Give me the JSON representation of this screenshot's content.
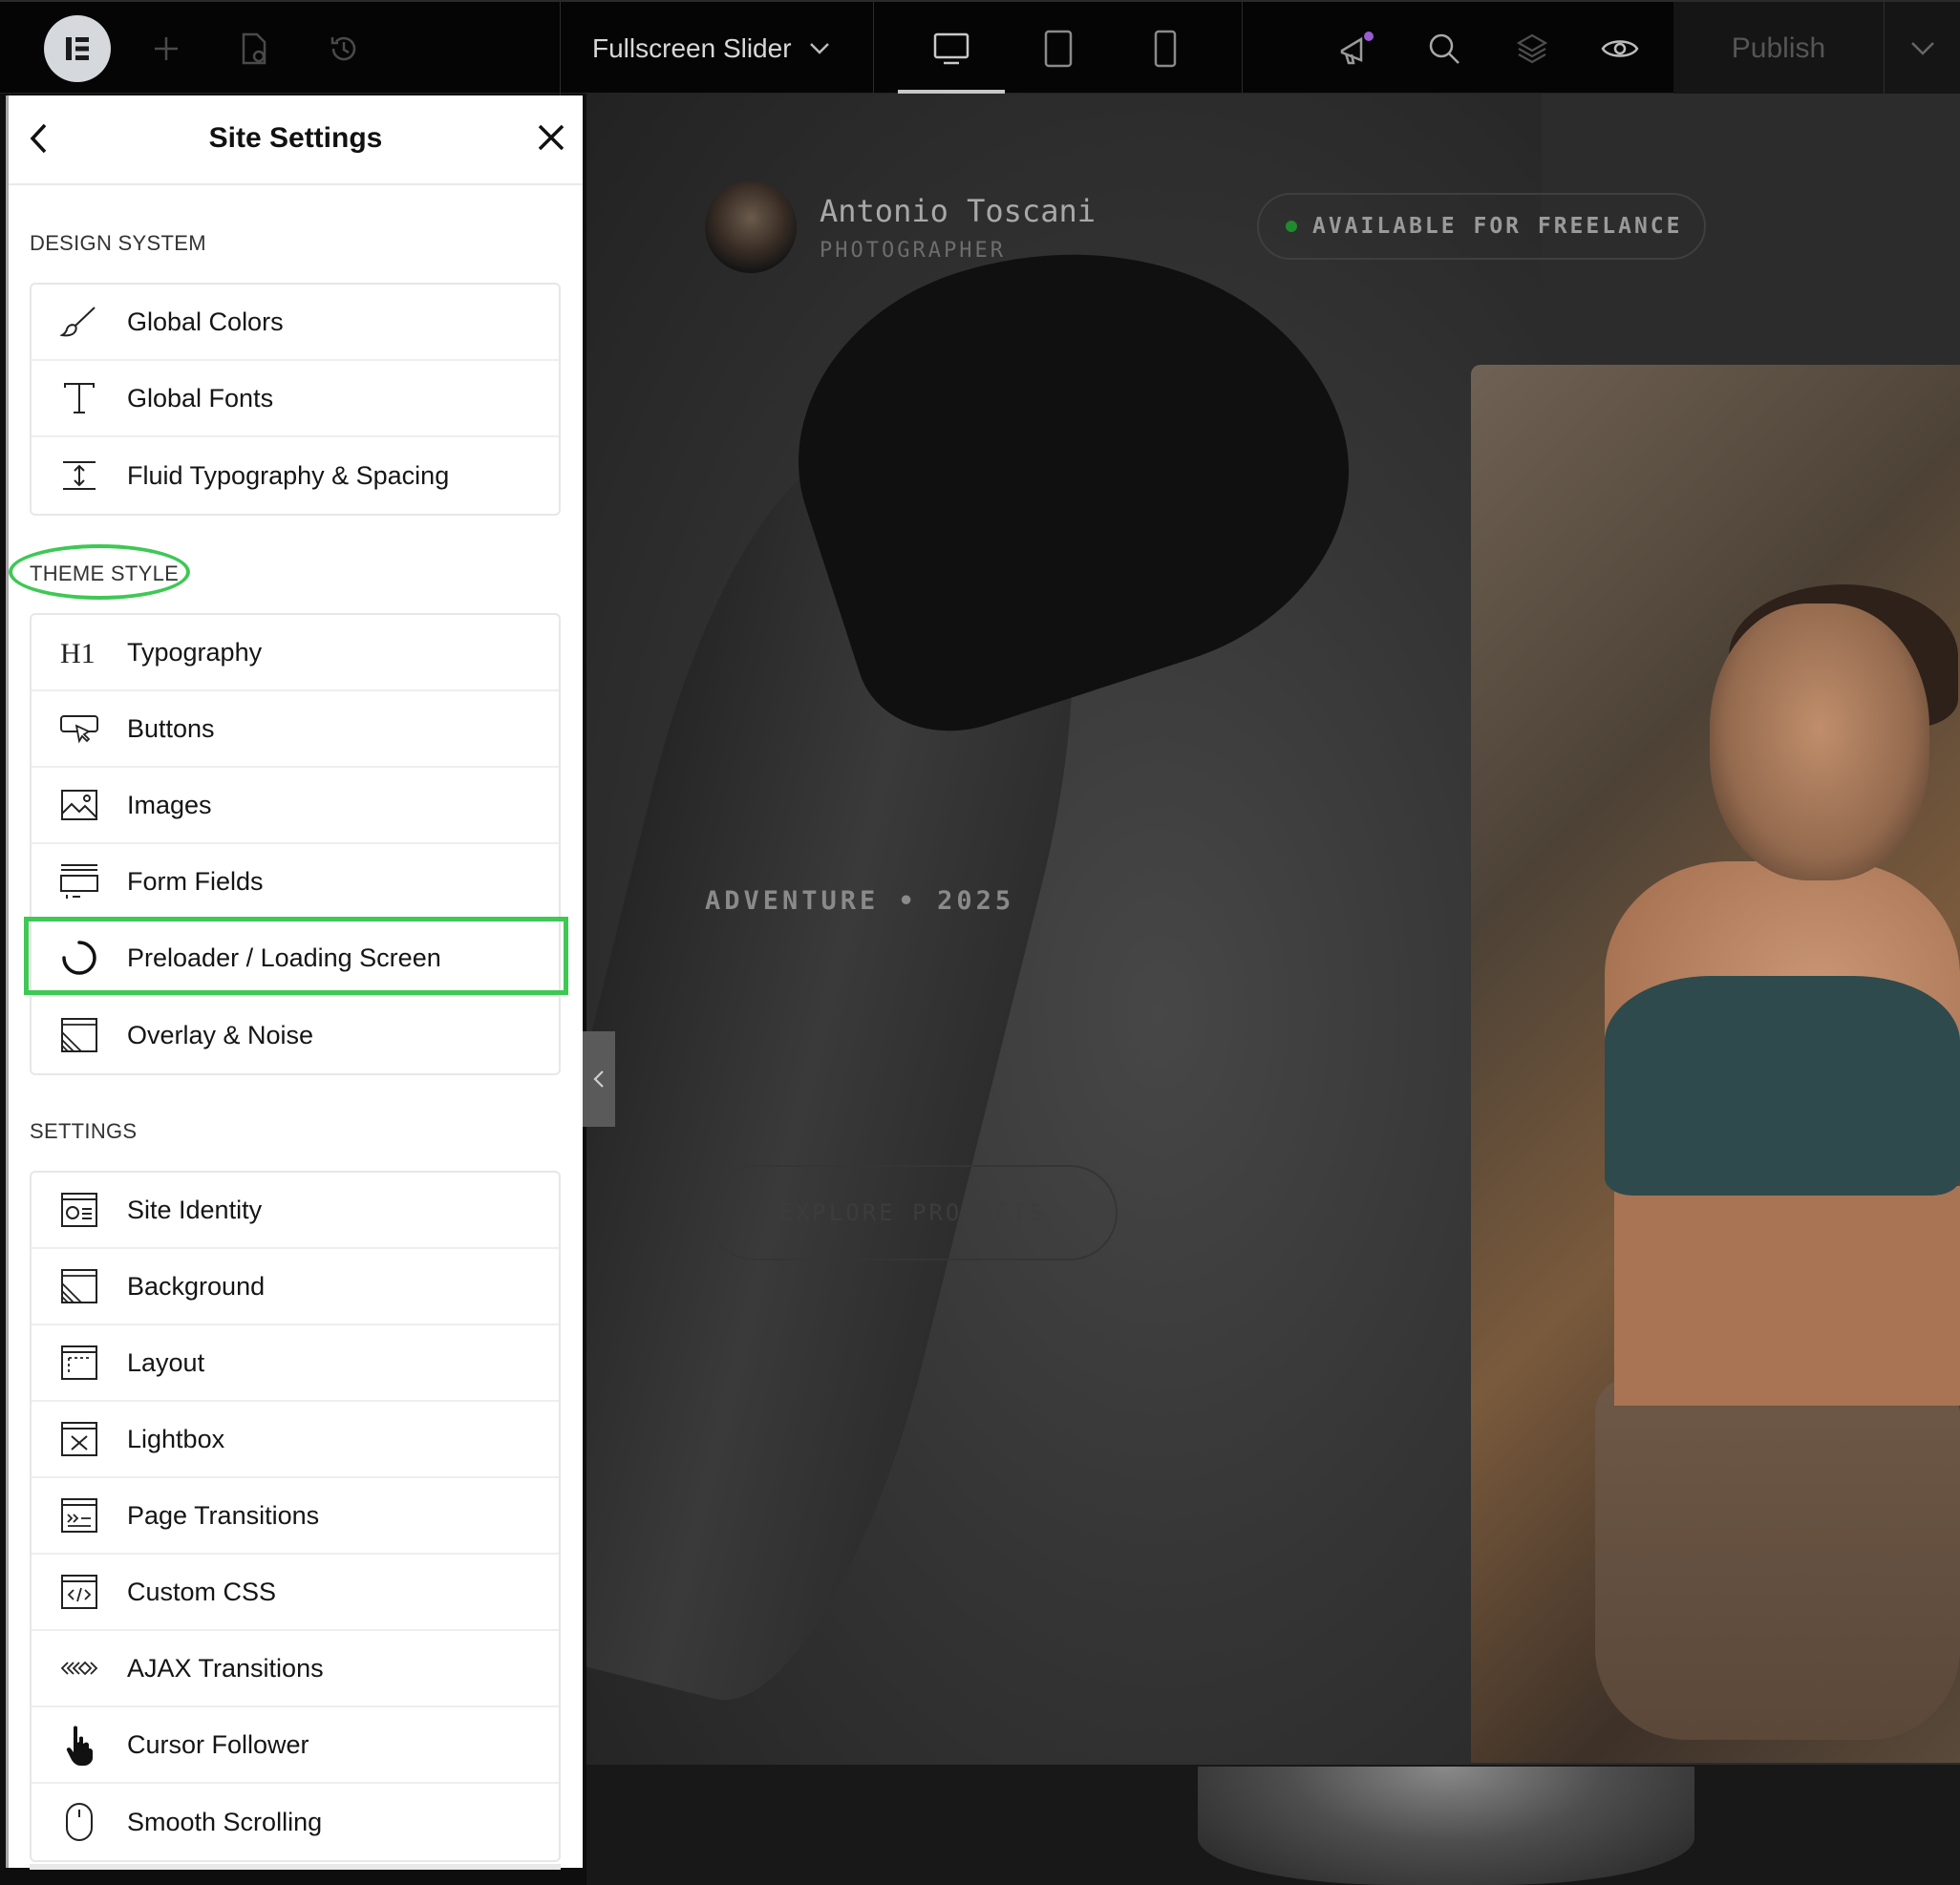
{
  "topbar": {
    "document_title": "Fullscreen Slider",
    "publish_label": "Publish"
  },
  "panel": {
    "title": "Site Settings",
    "sections": [
      {
        "label": "DESIGN SYSTEM",
        "items": [
          {
            "label": "Global Colors",
            "icon": "brush-icon"
          },
          {
            "label": "Global Fonts",
            "icon": "text-t-icon"
          },
          {
            "label": "Fluid Typography & Spacing",
            "icon": "spacing-icon"
          }
        ]
      },
      {
        "label": "THEME STYLE",
        "items": [
          {
            "label": "Typography",
            "icon": "h1-icon"
          },
          {
            "label": "Buttons",
            "icon": "button-cursor-icon"
          },
          {
            "label": "Images",
            "icon": "image-icon"
          },
          {
            "label": "Form Fields",
            "icon": "form-fields-icon"
          },
          {
            "label": "Preloader / Loading Screen",
            "icon": "spinner-icon"
          },
          {
            "label": "Overlay & Noise",
            "icon": "overlay-icon"
          }
        ]
      },
      {
        "label": "SETTINGS",
        "items": [
          {
            "label": "Site Identity",
            "icon": "id-card-icon"
          },
          {
            "label": "Background",
            "icon": "background-icon"
          },
          {
            "label": "Layout",
            "icon": "layout-icon"
          },
          {
            "label": "Lightbox",
            "icon": "lightbox-icon"
          },
          {
            "label": "Page Transitions",
            "icon": "page-transition-icon"
          },
          {
            "label": "Custom CSS",
            "icon": "code-icon"
          },
          {
            "label": "AJAX Transitions",
            "icon": "ajax-icon"
          },
          {
            "label": "Cursor Follower",
            "icon": "hand-pointer-icon"
          },
          {
            "label": "Smooth Scrolling",
            "icon": "mouse-icon"
          }
        ]
      }
    ]
  },
  "canvas": {
    "name": "Antonio Toscani",
    "role": "PHOTOGRAPHER",
    "availability": "AVAILABLE FOR FREELANCE",
    "tagline": "ADVENTURE • 2025",
    "cta": "EXPLORE PROJECTS"
  },
  "colors": {
    "highlight": "#3ec854",
    "topbar_bg": "#050505",
    "panel_bg": "#ffffff",
    "status_dot": "#1f8a2e",
    "notification_dot": "#9b5bd1"
  }
}
